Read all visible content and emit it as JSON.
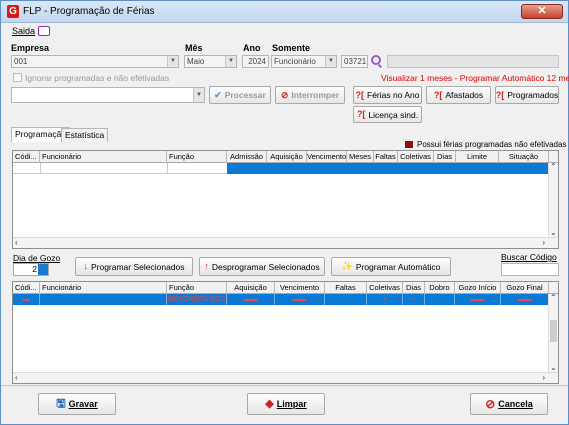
{
  "window": {
    "title": "FLP - Programação de Férias",
    "close": "✕"
  },
  "menu": {
    "saida": "Saida"
  },
  "filters": {
    "empresa_label": "Empresa",
    "empresa_value": "001",
    "mes_label": "Mês",
    "mes_value": "Maio",
    "ano_label": "Ano",
    "ano_value": "2024",
    "somente_label": "Somente",
    "somente_value": "Funcionário",
    "funcionario_code": "03721",
    "ignorar_label": "Ignorar programadas e não efetivadas",
    "visualizar_note": "Visualizar 1 meses - Programar Automático 12 meses"
  },
  "actions": {
    "processar": "Processar",
    "interromper": "Interromper",
    "ferias_no_ano": "Férias no Ano",
    "afastados": "Afastados",
    "programados": "Programados",
    "licenca_sind": "Licença sind."
  },
  "tabs": [
    {
      "label": "Programação"
    },
    {
      "label": "Estatística"
    }
  ],
  "legend": {
    "text": "Possui férias programadas não efetivadas",
    "color": "#8b1010"
  },
  "top_grid": {
    "columns": [
      "Códi...",
      "Funcionário",
      "Função",
      "Admissão",
      "Aquisição",
      "Vencimento",
      "Meses",
      "Faltas",
      "Coletivas",
      "Dias",
      "Limite",
      "Situação"
    ]
  },
  "middle": {
    "dia_de_gozo_label": "Dia de Gozo",
    "dia_de_gozo_value": "2",
    "programar_selecionados": "Programar Selecionados",
    "desprogramar_selecionados": "Desprogramar Selecionados",
    "programar_automatico": "Programar Automático",
    "buscar_codigo_label": "Buscar Código"
  },
  "bottom_grid": {
    "columns": [
      "Códi...",
      "Funcionário",
      "Função",
      "Aquisição",
      "Vencimento",
      "Faltas",
      "Coletivas",
      "Dias",
      "Dobro",
      "Gozo Início",
      "Gozo Final"
    ],
    "selected_row": {
      "funcao": "MOTORISTA ROD"
    }
  },
  "footer": {
    "gravar": "Gravar",
    "limpar": "Limpar",
    "cancela": "Cancela"
  },
  "colors": {
    "selection": "#0a7ad6",
    "accent_red": "#e00000",
    "title_bar": "#c3d7ee"
  }
}
